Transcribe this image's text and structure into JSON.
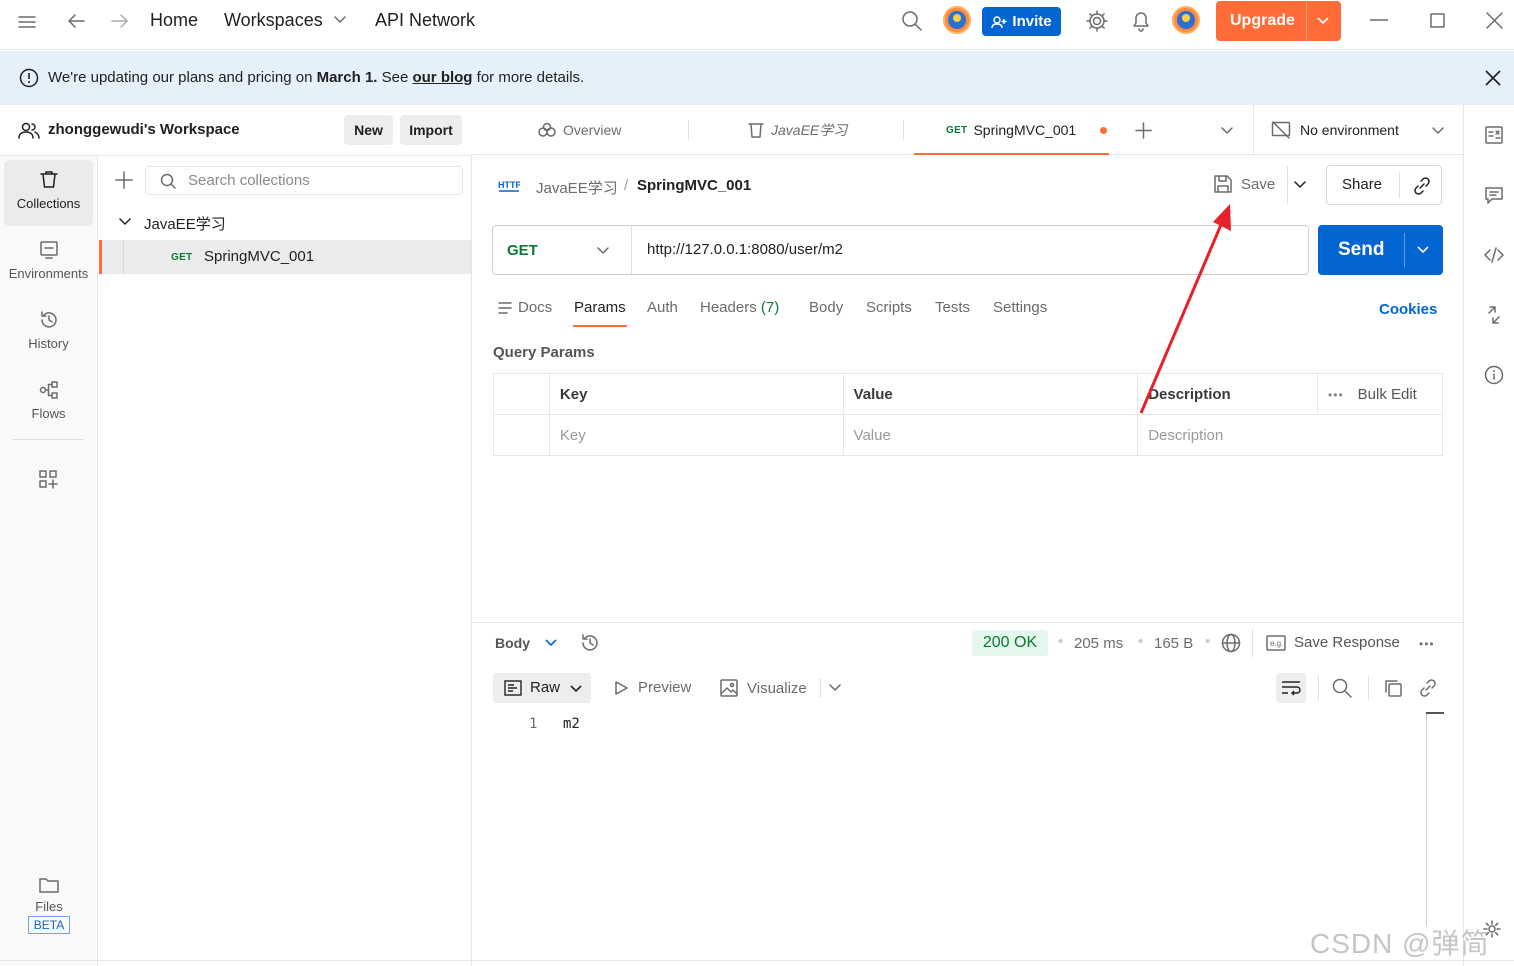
{
  "topbar": {
    "nav": [
      "Home",
      "Workspaces",
      "API Network"
    ],
    "invite_label": "Invite",
    "upgrade_label": "Upgrade"
  },
  "banner": {
    "text_a": "We're updating our plans and pricing on ",
    "text_bold": "March 1.",
    "text_b": " See ",
    "link": "our blog",
    "text_c": " for more details."
  },
  "workspace": {
    "name": "zhonggewudi's Workspace",
    "new_label": "New",
    "import_label": "Import"
  },
  "rail": {
    "items": [
      "Collections",
      "Environments",
      "History",
      "Flows"
    ],
    "files_label": "Files",
    "beta_label": "BETA"
  },
  "collections": {
    "search_placeholder": "Search collections",
    "folder": "JavaEE学习",
    "request_method": "GET",
    "request_name": "SpringMVC_001"
  },
  "tabs": {
    "overview": "Overview",
    "collection": "JavaEE学习",
    "active_method": "GET",
    "active_name": "SpringMVC_001",
    "environment": "No environment"
  },
  "request": {
    "breadcrumb_parent": "JavaEE学习",
    "breadcrumb_sep": "/",
    "breadcrumb_current": "SpringMVC_001",
    "save_label": "Save",
    "share_label": "Share",
    "method": "GET",
    "url": "http://127.0.0.1:8080/user/m2",
    "send_label": "Send",
    "tabs": [
      "Docs",
      "Params",
      "Auth",
      "Headers",
      "Body",
      "Scripts",
      "Tests",
      "Settings"
    ],
    "headers_count": "(7)",
    "cookies_label": "Cookies",
    "query_params_title": "Query Params",
    "columns": [
      "Key",
      "Value",
      "Description"
    ],
    "bulk_edit": "Bulk Edit",
    "placeholders": [
      "Key",
      "Value",
      "Description"
    ]
  },
  "response": {
    "body_label": "Body",
    "status": "200 OK",
    "time": "205 ms",
    "size": "165 B",
    "save_response": "Save Response",
    "format": "Raw",
    "preview": "Preview",
    "visualize": "Visualize",
    "line_number": "1",
    "line_content": "m2"
  },
  "watermark": "CSDN @弹简将",
  "colors": {
    "accent_blue": "#0265d2",
    "upgrade_orange": "#ff6c37",
    "status_green": "#0b7a33",
    "annotation_red": "#e8202a"
  }
}
